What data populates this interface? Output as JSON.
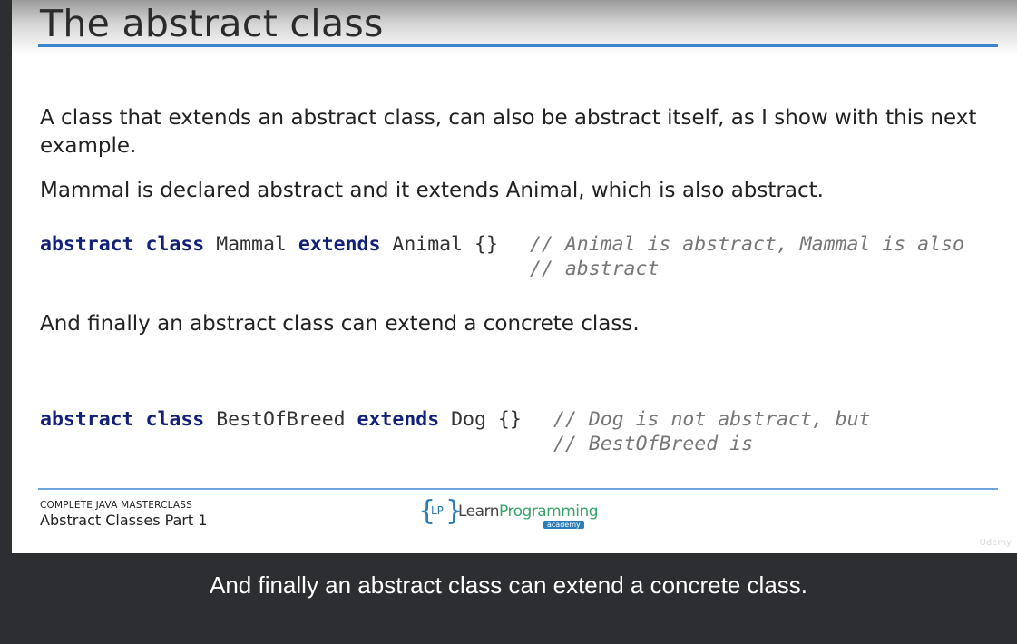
{
  "slide": {
    "title": "The abstract class",
    "para1": "A class that extends an abstract class, can also be abstract itself, as I show with this next example.",
    "para2": "Mammal is declared abstract and it extends Animal, which is also abstract.",
    "code1": {
      "kw1": "abstract",
      "kw2": "class",
      "name": "Mammal",
      "kw3": "extends",
      "rest": "Animal {}",
      "comment1": "// Animal is abstract, Mammal is also",
      "comment2": "// abstract"
    },
    "para3": "And finally an abstract class can extend a concrete class.",
    "code2": {
      "kw1": "abstract",
      "kw2": "class",
      "name": "BestOfBreed",
      "kw3": "extends",
      "rest": "Dog {}",
      "comment1": "// Dog is not abstract, but",
      "comment2": "// BestOfBreed is"
    },
    "footer": {
      "course": "COMPLETE JAVA MASTERCLASS",
      "lecture": "Abstract Classes Part 1"
    },
    "logo": {
      "brace_left": "{",
      "lp": "LP",
      "brace_right": "}",
      "text_a": "Learn",
      "text_b": "Programming",
      "academy": "academy"
    },
    "watermark": "Udemy"
  },
  "caption": "And finally an abstract class can extend a concrete class."
}
